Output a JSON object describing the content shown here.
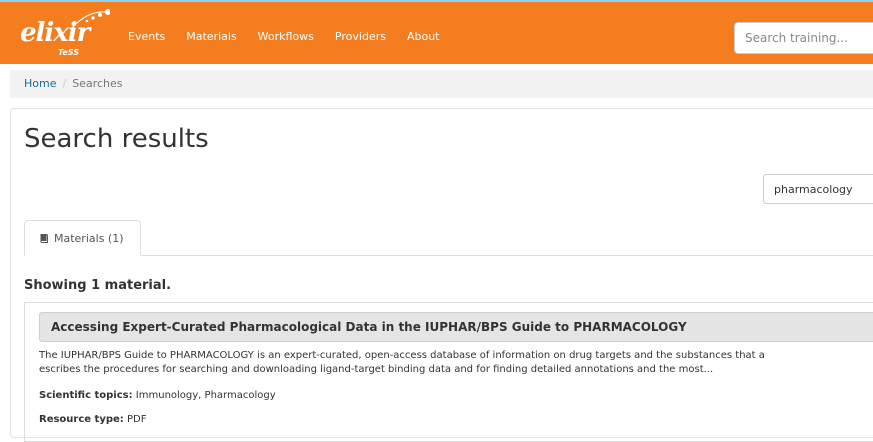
{
  "header": {
    "logo_text": "elixir",
    "logo_sub": "TeSS",
    "nav": [
      "Events",
      "Materials",
      "Workflows",
      "Providers",
      "About"
    ],
    "search_placeholder": "Search training...",
    "brand_color": "#f47d20"
  },
  "breadcrumb": {
    "home": "Home",
    "separator": "/",
    "current": "Searches"
  },
  "main": {
    "title": "Search results",
    "query": "pharmacology",
    "tabs": [
      {
        "label": "Materials (1)",
        "icon": "book-icon",
        "active": true
      }
    ],
    "showing": "Showing 1 material."
  },
  "results": [
    {
      "title": "Accessing Expert-Curated Pharmacological Data in the IUPHAR/BPS Guide to PHARMACOLOGY",
      "description_line1": "The IUPHAR/BPS Guide to PHARMACOLOGY is an expert-curated, open-access database of information on drug targets and the substances that a",
      "description_line2": "escribes the procedures for searching and downloading ligand-target binding data and for finding detailed annotations and the most...",
      "topics_label": "Scientific topics:",
      "topics_value": "Immunology, Pharmacology",
      "resource_label": "Resource type:",
      "resource_value": "PDF"
    }
  ]
}
